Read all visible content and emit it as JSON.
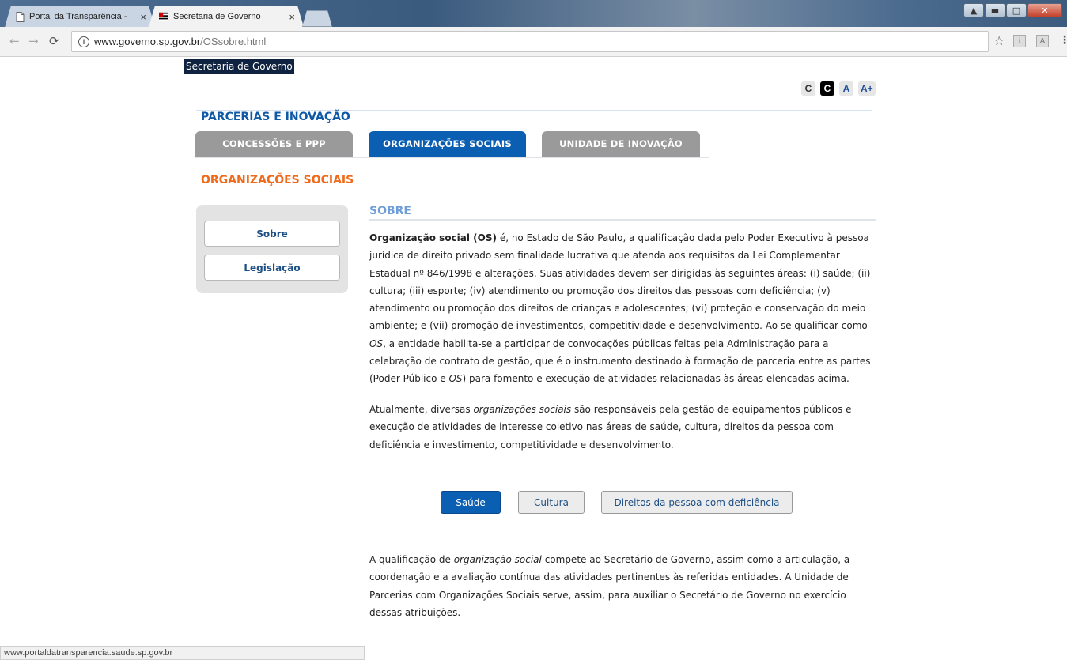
{
  "browser": {
    "tabs": [
      {
        "title": "Portal da Transparência - ",
        "active": false
      },
      {
        "title": "Secretaria de Governo",
        "active": true
      }
    ],
    "url_host": "www.governo.sp.gov.br",
    "url_path": "/OSsobre.html",
    "extensions": [
      "i",
      "A"
    ],
    "status_url": "www.portaldatransparencia.saude.sp.gov.br"
  },
  "page": {
    "site_label": "Secretaria de Governo",
    "a11y": [
      "C",
      "C",
      "A",
      "A+"
    ],
    "section_title": "PARCERIAS E INOVAÇÃO",
    "tabs": [
      {
        "label": "CONCESSÕES E PPP"
      },
      {
        "label": "ORGANIZAÇÕES SOCIAIS"
      },
      {
        "label": "UNIDADE DE INOVAÇÃO"
      }
    ],
    "os_heading": "ORGANIZAÇÕES SOCIAIS",
    "sidebar": [
      {
        "label": "Sobre"
      },
      {
        "label": "Legislação"
      }
    ],
    "sobre_title": "SOBRE",
    "p1_bold": "Organização social (OS)",
    "p1_a": " é, no Estado de São Paulo, a qualificação dada pelo Poder Executivo à pessoa jurídica de direito privado sem finalidade lucrativa que atenda aos requisitos da Lei Complementar Estadual nº 846/1998 e alterações. Suas atividades devem ser dirigidas às seguintes áreas: (i) saúde; (ii) cultura; (iii) esporte; (iv) atendimento ou promoção dos direitos das pessoas com deficiência; (v) atendimento ou promoção dos direitos de crianças e adolescentes; (vi) proteção e conservação do meio ambiente; e (vii) promoção de investimentos, competitividade e desenvolvimento. Ao se qualificar como ",
    "p1_os1": "OS",
    "p1_b": ", a entidade habilita-se a participar de convocações públicas feitas pela Administração para a celebração de contrato de gestão, que é o instrumento destinado à formação de parceria entre as partes (Poder Público e ",
    "p1_os2": "OS",
    "p1_c": ") para fomento e execução de atividades relacionadas às áreas elencadas acima.",
    "p2_a": "Atualmente, diversas ",
    "p2_em": "organizações sociais",
    "p2_b": " são responsáveis pela gestão de equipamentos públicos e execução de atividades de interesse coletivo nas áreas de saúde, cultura, direitos da pessoa com deficiência e investimento, competitividade e desenvolvimento.",
    "buttons": [
      {
        "label": "Saúde"
      },
      {
        "label": "Cultura"
      },
      {
        "label": "Direitos da pessoa com deficiência"
      }
    ],
    "p3_a": "A qualificação de ",
    "p3_em": "organização social",
    "p3_b": " compete ao Secretário de Governo, assim como a articulação, a coordenação e a avaliação contínua das atividades pertinentes às referidas entidades. A Unidade de Parcerias com Organizações Sociais serve, assim, para auxiliar o Secretário de Governo no exercício dessas atribuições."
  }
}
